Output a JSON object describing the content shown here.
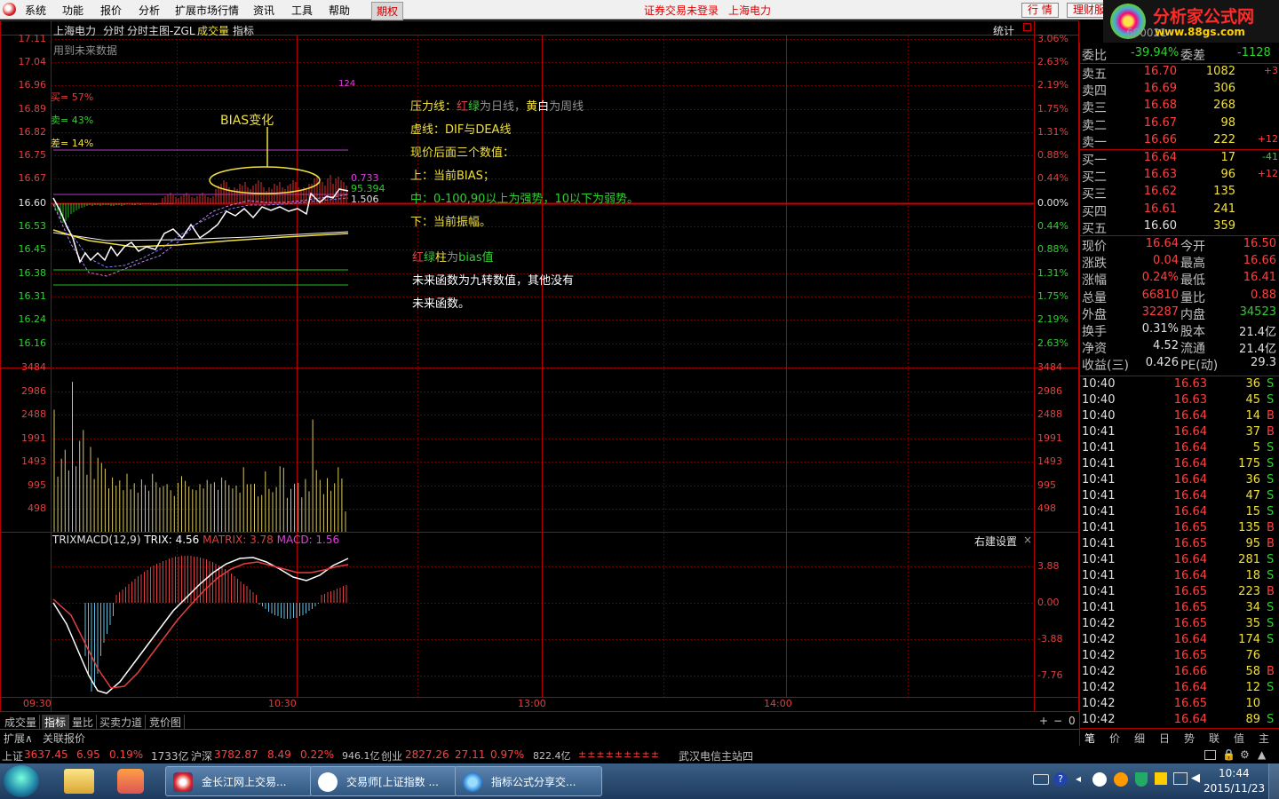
{
  "menu": {
    "items": [
      "系统",
      "功能",
      "报价",
      "分析",
      "扩展市场行情",
      "资讯",
      "工具",
      "帮助"
    ],
    "futures": "期权",
    "login": "证券交易未登录",
    "stock_name": "上海电力",
    "btn_quote": "行 情",
    "btn_finance": "理财服"
  },
  "brand": {
    "name": "分析家公式网",
    "url": "www.88gs.com",
    "code_partial": "600021"
  },
  "chart": {
    "header_tabs": [
      "上海电力",
      "分时",
      "分时主图-ZGL",
      "成交量",
      "指标"
    ],
    "stats_label": "统计",
    "future_data_note": "用到未来数据",
    "buy_pct": "买= 57%",
    "sell_pct": "卖= 43%",
    "diff_pct": "差= 14%",
    "bias_title": "BIAS变化",
    "bias_values": [
      "0.733",
      "95.394",
      "1.506"
    ],
    "mini_label": "124",
    "price_ticks": [
      "17.11",
      "17.04",
      "16.96",
      "16.89",
      "16.82",
      "16.75",
      "16.67",
      "16.60",
      "16.53",
      "16.45",
      "16.38",
      "16.31",
      "16.24",
      "16.16"
    ],
    "pct_ticks": [
      "3.06%",
      "2.63%",
      "2.19%",
      "1.75%",
      "1.31%",
      "0.88%",
      "0.44%",
      "0.00%",
      "0.44%",
      "0.88%",
      "1.31%",
      "1.75%",
      "2.19%",
      "2.63%"
    ],
    "vol_ticks": [
      "3484",
      "2986",
      "2488",
      "1991",
      "1493",
      "995",
      "498"
    ],
    "macd_ticks": [
      "3.88",
      "0.00",
      "-3.88",
      "-7.76"
    ],
    "time_ticks": [
      "09:30",
      "10:30",
      "13:00",
      "14:00"
    ],
    "macd_label": {
      "name": "TRIXMACD(12,9)",
      "trix": "TRIX: 4.56",
      "matrix": "MATRIX: 3.78",
      "macd": "MACD: 1.56"
    },
    "right_settings": "右建设置",
    "annotations": {
      "l1": {
        "a": "压力线：",
        "b": "红",
        "c": "绿",
        "d": "为日线，",
        "e": "黄",
        "f": "白",
        "g": "为周线"
      },
      "l2": "虚线：DIF与DEA线",
      "l3": "现价后面三个数值：",
      "l4": "上：当前BIAS；",
      "l5": "中：0-100,90以上为强势，10以下为弱势。",
      "l6": "下：当前振幅。",
      "l7": {
        "a": "红",
        "b": "绿",
        "c": "柱",
        "d": "为",
        "e": "bias值"
      },
      "l8": "未来函数为九转数值，其他没有",
      "l9": "未来函数。"
    }
  },
  "volume_values": [
    2590,
    1170,
    1550,
    1740,
    1300,
    3180,
    1390,
    1930,
    2160,
    1210,
    1800,
    1120,
    1570,
    1460,
    1340,
    920,
    1150,
    980,
    1090,
    880,
    1230,
    900,
    1030,
    830,
    1110,
    990,
    870,
    1230,
    1050,
    940,
    970,
    1010,
    880,
    760,
    1040,
    1180,
    1080,
    960,
    900,
    880,
    1010,
    920,
    1100,
    1020,
    1050,
    890,
    1150,
    1090,
    990,
    920,
    980,
    830,
    1370,
    1010,
    1010,
    1020,
    750,
    780,
    1280,
    910,
    840,
    950,
    1390,
    1360,
    720,
    910,
    1020,
    1040,
    730,
    1120,
    860,
    2380,
    1310,
    1100,
    800,
    1140,
    870,
    1030,
    1370,
    1130,
    430
  ],
  "bottom_tabs": [
    "成交量",
    "指标",
    "量比",
    "买卖力道",
    "竞价图"
  ],
  "bottom_tabs2": [
    "扩展∧",
    "关联报价"
  ],
  "quote": {
    "ratio": {
      "label": "委比",
      "value": "-39.94%",
      "label2": "委差",
      "value2": "-1128"
    },
    "asks": [
      {
        "l": "卖五",
        "p": "16.70",
        "v": "1082",
        "c": "+3"
      },
      {
        "l": "卖四",
        "p": "16.69",
        "v": "306",
        "c": ""
      },
      {
        "l": "卖三",
        "p": "16.68",
        "v": "268",
        "c": ""
      },
      {
        "l": "卖二",
        "p": "16.67",
        "v": "98",
        "c": ""
      },
      {
        "l": "卖一",
        "p": "16.66",
        "v": "222",
        "c": "+12"
      }
    ],
    "bids": [
      {
        "l": "买一",
        "p": "16.64",
        "v": "17",
        "c": "-41"
      },
      {
        "l": "买二",
        "p": "16.63",
        "v": "96",
        "c": "+12"
      },
      {
        "l": "买三",
        "p": "16.62",
        "v": "135",
        "c": ""
      },
      {
        "l": "买四",
        "p": "16.61",
        "v": "241",
        "c": ""
      },
      {
        "l": "买五",
        "p": "16.60",
        "v": "359",
        "c": ""
      }
    ],
    "stats": [
      {
        "a": "现价",
        "av": "16.64",
        "b": "今开",
        "bv": "16.50"
      },
      {
        "a": "涨跌",
        "av": "0.04",
        "b": "最高",
        "bv": "16.66"
      },
      {
        "a": "涨幅",
        "av": "0.24%",
        "b": "最低",
        "bv": "16.41"
      },
      {
        "a": "总量",
        "av": "66810",
        "b": "量比",
        "bv": "0.88"
      },
      {
        "a": "外盘",
        "av": "32287",
        "b": "内盘",
        "bv": "34523"
      },
      {
        "a": "换手",
        "av": "0.31%",
        "b": "股本",
        "bv": "21.4亿"
      },
      {
        "a": "净资",
        "av": "4.52",
        "b": "流通",
        "bv": "21.4亿"
      },
      {
        "a": "收益(三)",
        "av": "0.426",
        "b": "PE(动)",
        "bv": "29.3"
      }
    ],
    "ticks": [
      [
        "10:40",
        "16.63",
        "36",
        "S"
      ],
      [
        "10:40",
        "16.63",
        "45",
        "S"
      ],
      [
        "10:40",
        "16.64",
        "14",
        "B"
      ],
      [
        "10:41",
        "16.64",
        "37",
        "B"
      ],
      [
        "10:41",
        "16.64",
        "5",
        "S"
      ],
      [
        "10:41",
        "16.64",
        "175",
        "S"
      ],
      [
        "10:41",
        "16.64",
        "36",
        "S"
      ],
      [
        "10:41",
        "16.64",
        "47",
        "S"
      ],
      [
        "10:41",
        "16.64",
        "15",
        "S"
      ],
      [
        "10:41",
        "16.65",
        "135",
        "B"
      ],
      [
        "10:41",
        "16.65",
        "95",
        "B"
      ],
      [
        "10:41",
        "16.64",
        "281",
        "S"
      ],
      [
        "10:41",
        "16.64",
        "18",
        "S"
      ],
      [
        "10:41",
        "16.65",
        "223",
        "B"
      ],
      [
        "10:41",
        "16.65",
        "34",
        "S"
      ],
      [
        "10:42",
        "16.65",
        "35",
        "S"
      ],
      [
        "10:42",
        "16.64",
        "174",
        "S"
      ],
      [
        "10:42",
        "16.65",
        "76",
        ""
      ],
      [
        "10:42",
        "16.66",
        "58",
        "B"
      ],
      [
        "10:42",
        "16.64",
        "12",
        "S"
      ],
      [
        "10:42",
        "16.65",
        "10",
        ""
      ],
      [
        "10:42",
        "16.64",
        "89",
        "S"
      ]
    ],
    "side_tabs": [
      "笔",
      "价",
      "细",
      "日",
      "势",
      "联",
      "值",
      "主"
    ]
  },
  "status": {
    "sh_label": "上证",
    "sh": "3637.45",
    "sh_chg": "6.95",
    "sh_pct": "0.19%",
    "sh_amt": "1733亿",
    "hs_label": "沪深",
    "hs": "3782.87",
    "hs_chg": "8.49",
    "hs_pct": "0.22%",
    "hs_amt": "946.1亿",
    "cy_label": "创业",
    "cy": "2827.26",
    "cy_chg": "27.11",
    "cy_pct": "0.97%",
    "cy_amt": "822.4亿",
    "arrows": "±±±±±±±±±",
    "server": "武汉电信主站四"
  },
  "taskbar": {
    "tasks": [
      "金长江网上交易...",
      "交易师[上证指数 ...",
      "指标公式分享交..."
    ],
    "time": "10:44",
    "date": "2015/11/23"
  }
}
